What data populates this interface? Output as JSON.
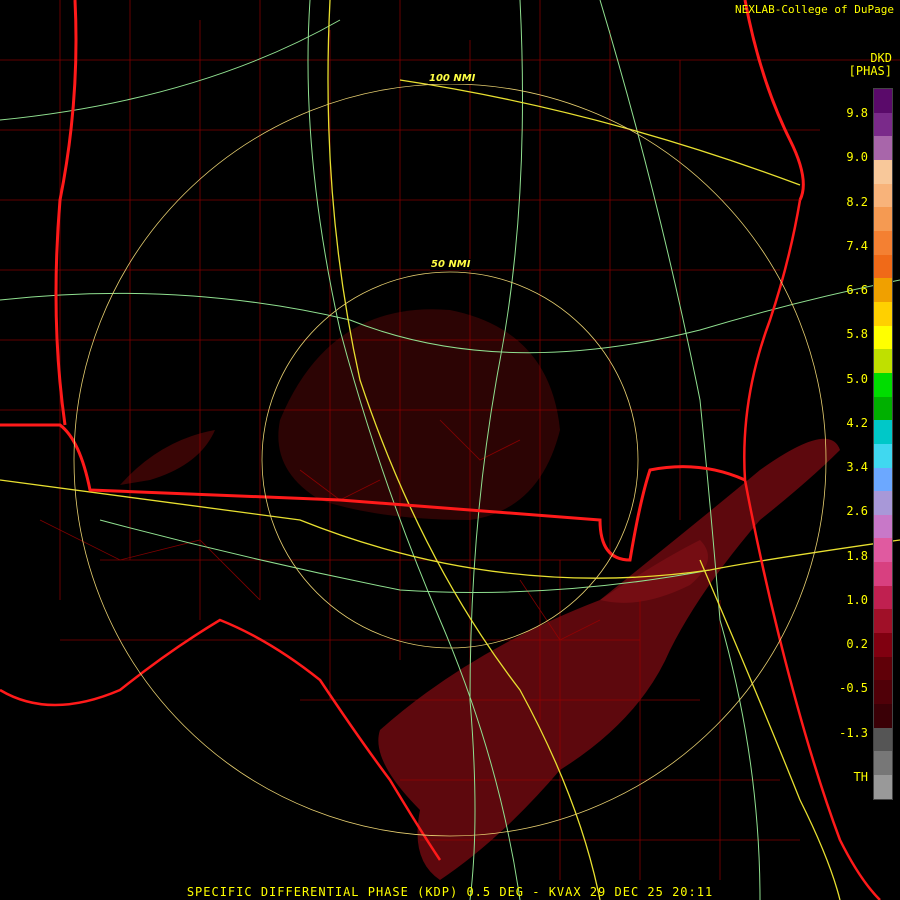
{
  "credit": "NEXLAB-College of DuPage",
  "legend": {
    "unit_line1": "DKD",
    "unit_line2": "[PHAS]",
    "ticks": [
      "9.8",
      "9.0",
      "8.2",
      "7.4",
      "6.6",
      "5.8",
      "5.0",
      "4.2",
      "3.4",
      "2.6",
      "1.8",
      "1.0",
      "0.2",
      "-0.5",
      "-1.3",
      "TH"
    ],
    "colors": [
      "#5a0a6a",
      "#7a2a8a",
      "#a866aa",
      "#f8c89a",
      "#f8b37a",
      "#f59a52",
      "#f48032",
      "#f06a18",
      "#f0a000",
      "#ffd000",
      "#ffff00",
      "#bfe000",
      "#00dd00",
      "#00b000",
      "#00c8c8",
      "#40d8f0",
      "#6ca8ff",
      "#a898d8",
      "#c878c8",
      "#e05aa0",
      "#d84080",
      "#c02050",
      "#a01028",
      "#800010",
      "#600008",
      "#500008",
      "#3a0006",
      "#555555",
      "#777777",
      "#999999"
    ]
  },
  "range_rings": {
    "inner": "50 NMI",
    "outer": "100 NMI"
  },
  "footer": "SPECIFIC DIFFERENTIAL PHASE (KDP) 0.5 DEG - KVAX 29 DEC 25 20:11"
}
